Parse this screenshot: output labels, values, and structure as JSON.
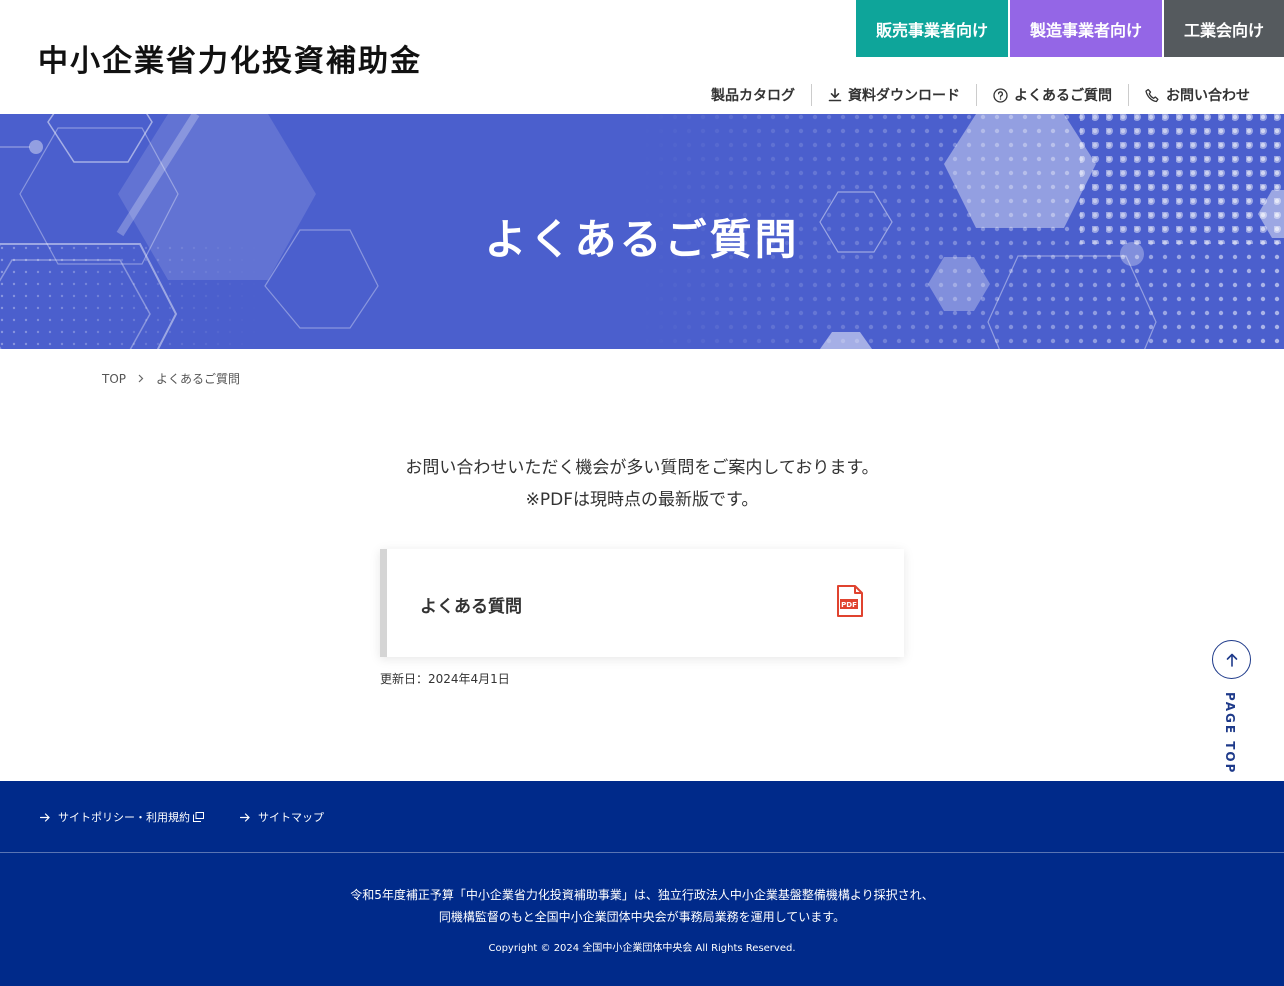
{
  "header": {
    "logo": "中小企業省力化投資補助金",
    "audience_tabs": [
      "販売事業者向け",
      "製造事業者向け",
      "工業会向け"
    ],
    "subnav": [
      "製品カタログ",
      "資料ダウンロード",
      "よくあるご質問",
      "お問い合わせ"
    ]
  },
  "hero": {
    "title": "よくあるご質問"
  },
  "breadcrumb": {
    "home": "TOP",
    "current": "よくあるご質問"
  },
  "main": {
    "intro_line1": "お問い合わせいただく機会が多い質問をご案内しております。",
    "intro_line2": "※PDFは現時点の最新版です。",
    "card_title": "よくある質問",
    "pdf_icon_label": "PDF",
    "updated": "更新日：2024年4月1日"
  },
  "pagetop": {
    "label": "PAGE TOP"
  },
  "footer": {
    "links": [
      "サイトポリシー・利用規約",
      "サイトマップ"
    ],
    "note_line1": "令和5年度補正予算「中小企業省力化投資補助事業」は、独立行政法人中小企業基盤整備機構より採択され、",
    "note_line2": "同機構監督のもと全国中小企業団体中央会が事務局業務を運用しています。",
    "copyright": "Copyright © 2024 全国中小企業団体中央会 All Rights Reserved."
  },
  "colors": {
    "teal": "#0ea59a",
    "purple": "#9466e6",
    "gray": "#555a5e",
    "hero_blue": "#4b5fcd",
    "footer_navy": "#002a8a",
    "pdf_red": "#e0432f"
  },
  "icons": [
    "download-icon",
    "question-circle-icon",
    "phone-icon",
    "pdf-file-icon",
    "arrow-up-icon",
    "arrow-right-icon",
    "external-window-icon"
  ]
}
